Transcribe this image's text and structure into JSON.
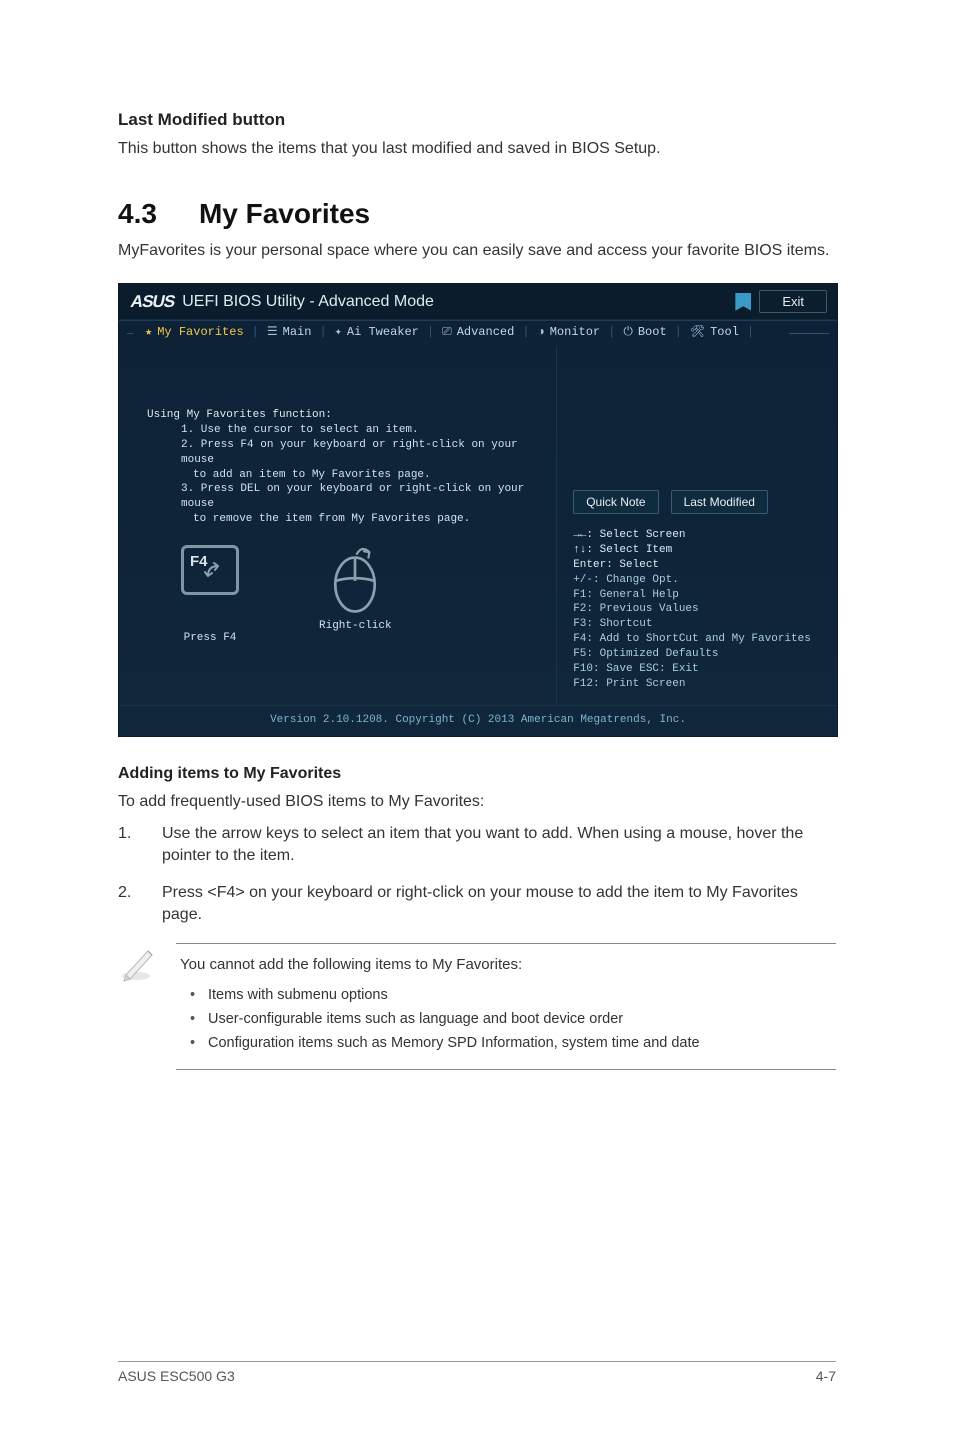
{
  "section_last_modified": {
    "heading": "Last Modified button",
    "body": "This button shows the items that you last modified and saved in BIOS Setup."
  },
  "section_myfav": {
    "num": "4.3",
    "title": "My Favorites",
    "intro": "MyFavorites is your personal space where you can easily save and access your favorite BIOS items."
  },
  "bios": {
    "brand": "ASUS",
    "title_suffix": "UEFI BIOS Utility - Advanced Mode",
    "exit": "Exit",
    "menu": {
      "myfav": "My Favorites",
      "main": "Main",
      "ai": "Ai Tweaker",
      "adv": "Advanced",
      "mon": "Monitor",
      "boot": "Boot",
      "tool": "Tool"
    },
    "left": {
      "hdr": "Using My Favorites function:",
      "l1": "1. Use the cursor to select an item.",
      "l2a": "2. Press F4 on your keyboard or right-click on your mouse",
      "l2b": "to add an item to My Favorites page.",
      "l3a": "3. Press DEL on your keyboard or right-click on your mouse",
      "l3b": "to remove the item from My Favorites page.",
      "key_label": "F4",
      "cap_press": "Press F4",
      "cap_click": "Right-click"
    },
    "right": {
      "quicknote": "Quick Note",
      "lastmod": "Last Modified",
      "h1": "→←: Select Screen",
      "h2": "↑↓: Select Item",
      "h3": "Enter: Select",
      "h4": "+/-: Change Opt.",
      "h5": "F1: General Help",
      "h6": "F2: Previous Values",
      "h7": "F3: Shortcut",
      "h8": "F4: Add to ShortCut and My Favorites",
      "h9": "F5: Optimized Defaults",
      "h10": "F10: Save  ESC: Exit",
      "h11": "F12: Print Screen"
    },
    "footer": "Version 2.10.1208. Copyright (C) 2013 American Megatrends, Inc."
  },
  "adding": {
    "heading": "Adding items to My Favorites",
    "intro": "To add frequently-used BIOS items to My Favorites:",
    "steps": [
      {
        "n": "1.",
        "t": "Use the arrow keys to select an item that you want to add. When using a mouse, hover the pointer to the item."
      },
      {
        "n": "2.",
        "t": "Press <F4> on your keyboard or right-click on your mouse to add the item to My Favorites page."
      }
    ]
  },
  "note": {
    "lead": "You cannot add the following items to My Favorites:",
    "items": [
      "Items with submenu options",
      "User-configurable items such as language and boot device order",
      "Configuration items such as Memory SPD Information, system time and date"
    ]
  },
  "footer": {
    "left": "ASUS ESC500 G3",
    "right": "4-7"
  }
}
